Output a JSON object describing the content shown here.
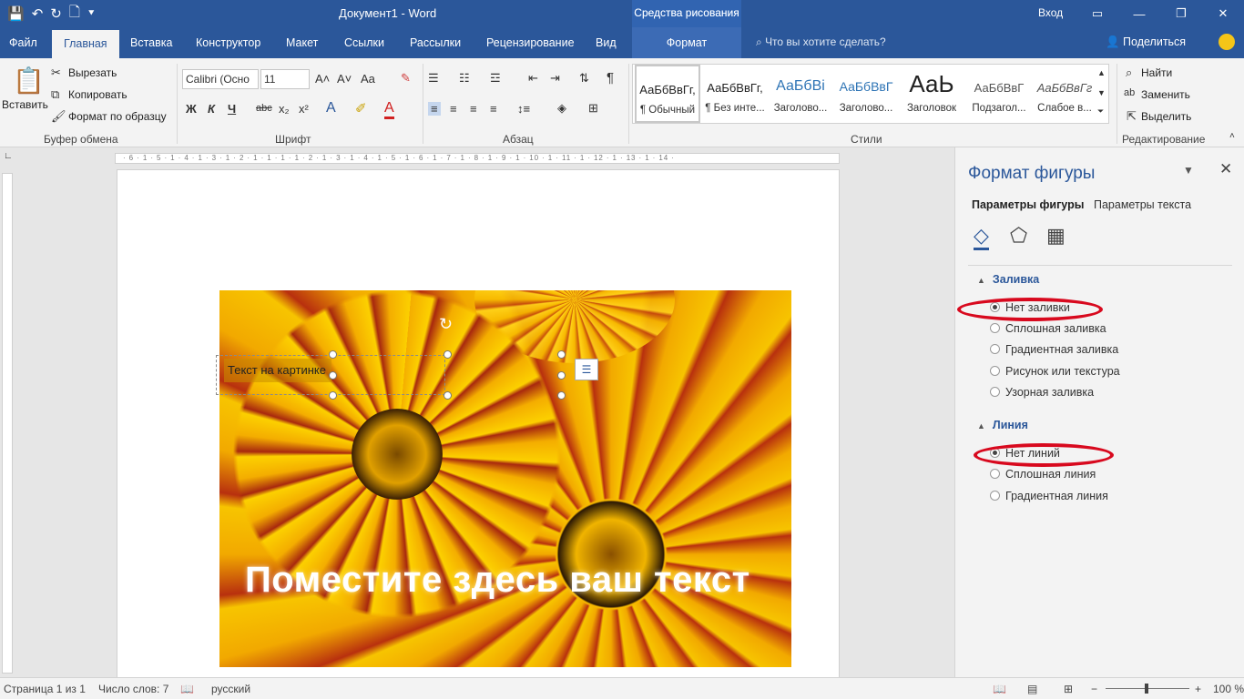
{
  "window": {
    "title": "Документ1 - Word",
    "context_group": "Средства рисования",
    "login": "Вход"
  },
  "tabs": [
    "Файл",
    "Главная",
    "Вставка",
    "Конструктор",
    "Макет",
    "Ссылки",
    "Рассылки",
    "Рецензирование",
    "Вид",
    "Формат"
  ],
  "tell_me": "Что вы хотите сделать?",
  "share": "Поделиться",
  "clipboard": {
    "paste": "Вставить",
    "cut": "Вырезать",
    "copy": "Копировать",
    "format_painter": "Формат по образцу",
    "label": "Буфер обмена"
  },
  "font": {
    "name": "Calibri (Осно",
    "size": "11",
    "label": "Шрифт",
    "bold": "Ж",
    "italic": "К",
    "underline": "Ч",
    "strike": "abc",
    "sub": "x₂",
    "sup": "x²",
    "case": "Aa"
  },
  "paragraph": {
    "label": "Абзац"
  },
  "styles": {
    "label": "Стили",
    "items": [
      {
        "preview": "АаБбВвГг,",
        "name": "¶ Обычный"
      },
      {
        "preview": "АаБбВвГг,",
        "name": "¶ Без инте..."
      },
      {
        "preview": "АаБбВі",
        "name": "Заголово..."
      },
      {
        "preview": "АаБбВвГ",
        "name": "Заголово..."
      },
      {
        "preview": "АаЬ",
        "name": "Заголовок"
      },
      {
        "preview": "АаБбВвГ",
        "name": "Подзагол..."
      },
      {
        "preview": "АаБбВвГг",
        "name": "Слабое в..."
      }
    ]
  },
  "editing": {
    "find": "Найти",
    "replace": "Заменить",
    "select": "Выделить",
    "label": "Редактирование"
  },
  "ruler": {
    "ticks": "· 6 · 1 · 5 · 1 · 4 · 1 · 3 · 1 · 2 · 1 · 1 · 1 · 1 · 2 · 1 · 3 · 1 · 4 · 1 · 5 · 1 · 6 · 1 · 7 · 1 · 8 · 1 · 9 · 1 · 10 · 1 · 11 · 1 · 12 · 1 · 13 · 1 · 14 ·"
  },
  "document": {
    "textbox_text": "Текст на картинке",
    "caption": "Поместите здесь ваш текст"
  },
  "pane": {
    "title": "Формат фигуры",
    "tab_shape": "Параметры фигуры",
    "tab_text": "Параметры текста",
    "fill_section": "Заливка",
    "fill_options": [
      "Нет заливки",
      "Сплошная заливка",
      "Градиентная заливка",
      "Рисунок или текстура",
      "Узорная заливка"
    ],
    "fill_selected": "Нет заливки",
    "line_section": "Линия",
    "line_options": [
      "Нет линий",
      "Сплошная линия",
      "Градиентная линия"
    ],
    "line_selected": "Нет линий",
    "highlight_color": "#d8091e"
  },
  "status": {
    "page": "Страница 1 из 1",
    "words": "Число слов: 7",
    "language": "русский",
    "zoom": "100 %"
  },
  "colors": {
    "accent": "#2b579a"
  }
}
